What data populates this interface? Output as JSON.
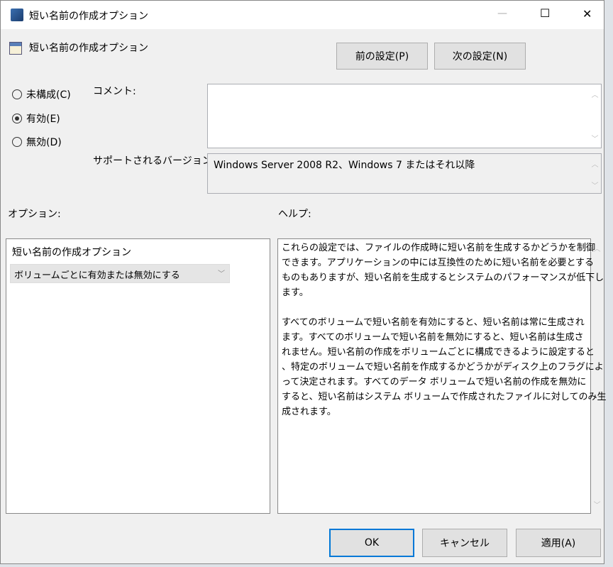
{
  "window": {
    "title": "短い名前の作成オプション",
    "minimize": "—",
    "maximize": "☐",
    "close": "✕"
  },
  "header": {
    "policy_name": "短い名前の作成オプション",
    "prev_label": "前の設定(P)",
    "next_label": "次の設定(N)"
  },
  "state": {
    "options": [
      {
        "label": "未構成(C)",
        "selected": false
      },
      {
        "label": "有効(E)",
        "selected": true
      },
      {
        "label": "無効(D)",
        "selected": false
      }
    ]
  },
  "comment": {
    "label": "コメント:",
    "value": ""
  },
  "supported": {
    "label": "サポートされるバージョン:",
    "value": "Windows Server 2008 R2、Windows 7 またはそれ以降"
  },
  "options_panel": {
    "label": "オプション:",
    "setting_label": "短い名前の作成オプション",
    "dropdown_value": "ボリュームごとに有効または無効にする"
  },
  "help_panel": {
    "label": "ヘルプ:",
    "lines": [
      "これらの設定では、ファイルの作成時に短い名前を生成するかどうかを制御",
      "できます。アプリケーションの中には互換性のために短い名前を必要とする",
      "ものもありますが、短い名前を生成するとシステムのパフォーマンスが低下し",
      "ます。",
      "",
      "すべてのボリュームで短い名前を有効にすると、短い名前は常に生成され",
      "ます。すべてのボリュームで短い名前を無効にすると、短い名前は生成さ",
      "れません。短い名前の作成をボリュームごとに構成できるように設定すると",
      "、特定のボリュームで短い名前を作成するかどうかがディスク上のフラグによ",
      "って決定されます。すべてのデータ ボリュームで短い名前の作成を無効に",
      "すると、短い名前はシステム ボリュームで作成されたファイルに対してのみ生",
      "成されます。"
    ]
  },
  "footer": {
    "ok": "OK",
    "cancel": "キャンセル",
    "apply": "適用(A)"
  },
  "colors": {
    "focus_border": "#0078d7",
    "dialog_bg": "#f0f0f0"
  }
}
